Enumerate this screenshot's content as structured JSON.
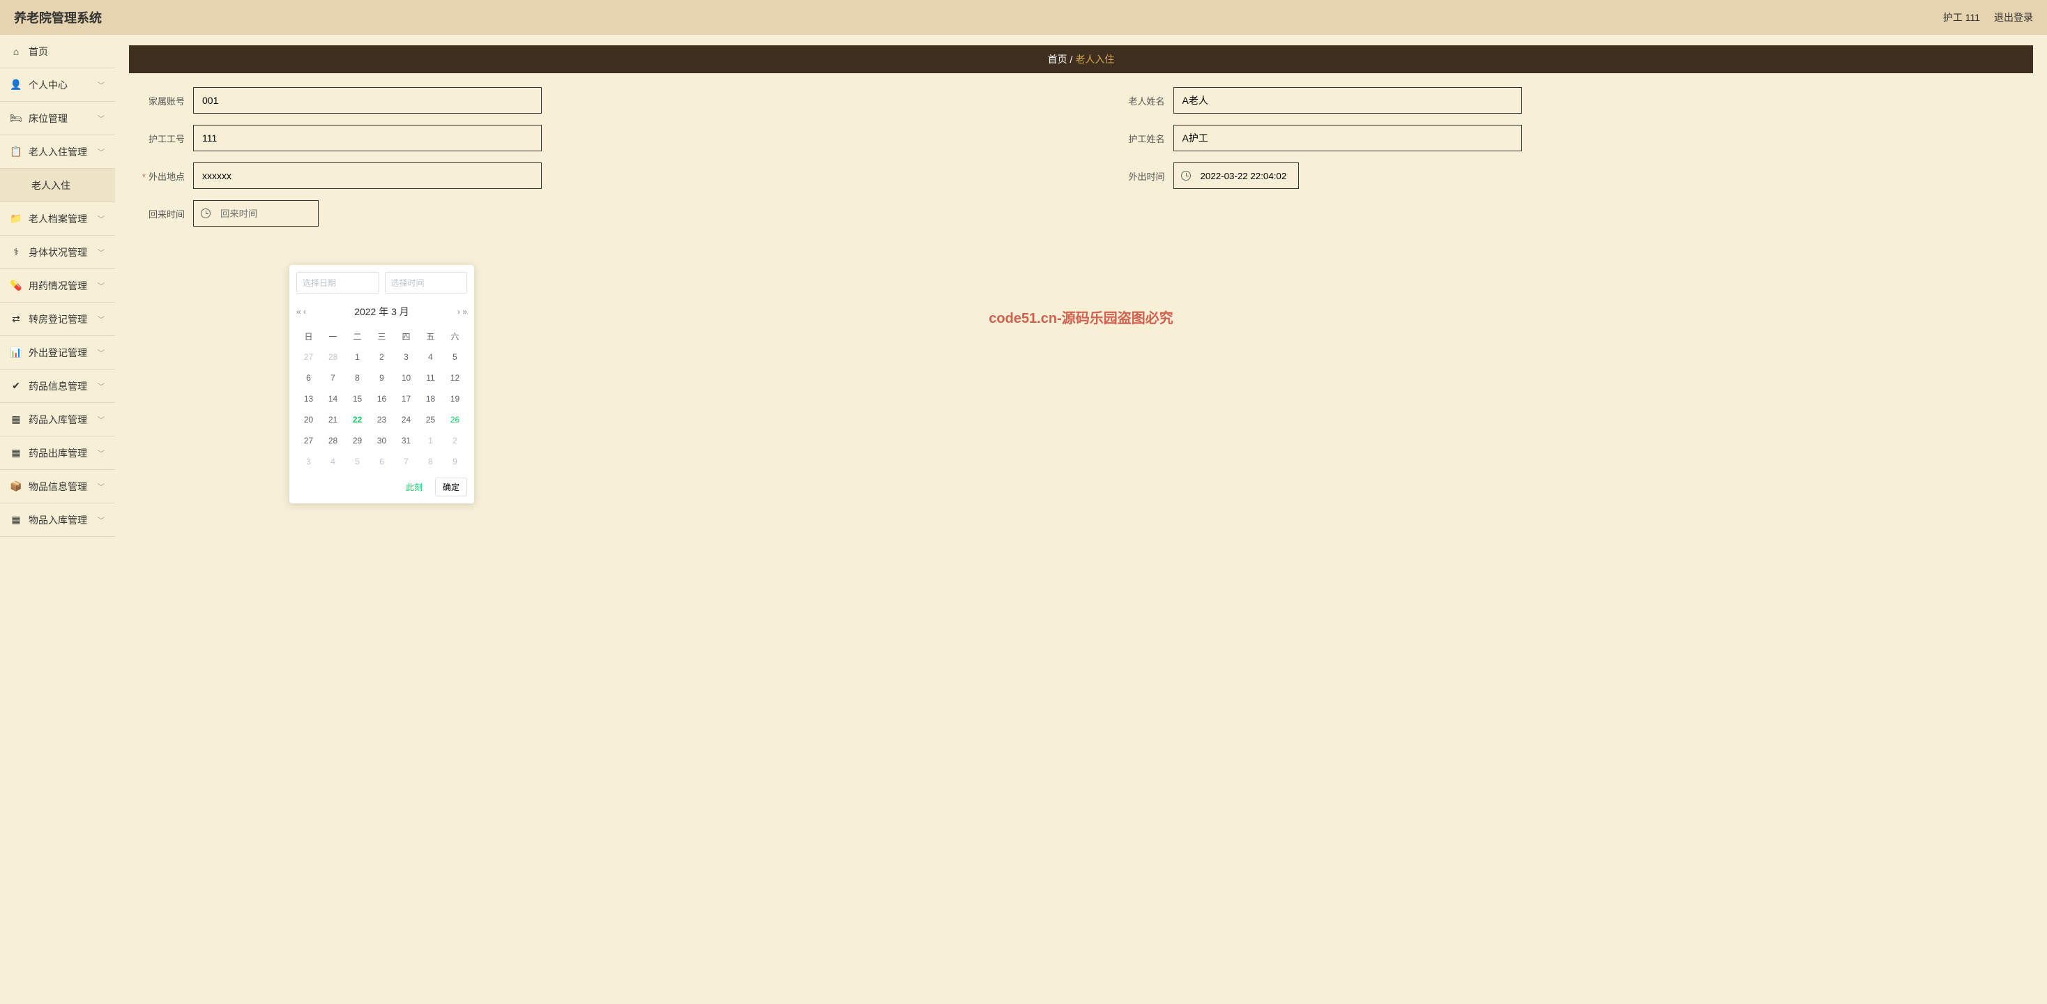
{
  "header": {
    "title": "养老院管理系统",
    "user_role": "护工 111",
    "logout": "退出登录"
  },
  "breadcrumb": {
    "home": "首页",
    "sep": " / ",
    "current": "老人入住"
  },
  "sidebar": [
    {
      "icon": "home",
      "label": "首页",
      "expandable": false
    },
    {
      "icon": "user",
      "label": "个人中心",
      "expandable": true
    },
    {
      "icon": "bed",
      "label": "床位管理",
      "expandable": true
    },
    {
      "icon": "checkin",
      "label": "老人入住管理",
      "expandable": true
    },
    {
      "icon": "",
      "label": "老人入住",
      "expandable": false,
      "sub": true
    },
    {
      "icon": "profile",
      "label": "老人档案管理",
      "expandable": true
    },
    {
      "icon": "body",
      "label": "身体状况管理",
      "expandable": true
    },
    {
      "icon": "med",
      "label": "用药情况管理",
      "expandable": true
    },
    {
      "icon": "room",
      "label": "转房登记管理",
      "expandable": true
    },
    {
      "icon": "out",
      "label": "外出登记管理",
      "expandable": true
    },
    {
      "icon": "drug",
      "label": "药品信息管理",
      "expandable": true
    },
    {
      "icon": "drugin",
      "label": "药品入库管理",
      "expandable": true
    },
    {
      "icon": "drugout",
      "label": "药品出库管理",
      "expandable": true
    },
    {
      "icon": "item",
      "label": "物品信息管理",
      "expandable": true
    },
    {
      "icon": "itemin",
      "label": "物品入库管理",
      "expandable": true
    }
  ],
  "form": {
    "family_account": {
      "label": "家属账号",
      "value": "001"
    },
    "elder_name": {
      "label": "老人姓名",
      "value": "A老人"
    },
    "nurse_id": {
      "label": "护工工号",
      "value": "111"
    },
    "nurse_name": {
      "label": "护工姓名",
      "value": "A护工"
    },
    "out_place": {
      "label": "外出地点",
      "value": "xxxxxx"
    },
    "out_time": {
      "label": "外出时间",
      "value": "2022-03-22 22:04:02"
    },
    "return_time": {
      "label": "回来时间",
      "placeholder": "回来时间"
    }
  },
  "datepicker": {
    "date_ph": "选择日期",
    "time_ph": "选择时间",
    "title": "2022 年   3 月",
    "weekdays": [
      "日",
      "一",
      "二",
      "三",
      "四",
      "五",
      "六"
    ],
    "weeks": [
      [
        {
          "d": 27,
          "o": true
        },
        {
          "d": 28,
          "o": true
        },
        {
          "d": 1
        },
        {
          "d": 2
        },
        {
          "d": 3
        },
        {
          "d": 4
        },
        {
          "d": 5
        }
      ],
      [
        {
          "d": 6
        },
        {
          "d": 7
        },
        {
          "d": 8
        },
        {
          "d": 9
        },
        {
          "d": 10
        },
        {
          "d": 11
        },
        {
          "d": 12
        }
      ],
      [
        {
          "d": 13
        },
        {
          "d": 14
        },
        {
          "d": 15
        },
        {
          "d": 16
        },
        {
          "d": 17
        },
        {
          "d": 18
        },
        {
          "d": 19
        }
      ],
      [
        {
          "d": 20
        },
        {
          "d": 21
        },
        {
          "d": 22,
          "t": true
        },
        {
          "d": 23
        },
        {
          "d": 24
        },
        {
          "d": 25
        },
        {
          "d": 26,
          "h": true
        }
      ],
      [
        {
          "d": 27
        },
        {
          "d": 28
        },
        {
          "d": 29
        },
        {
          "d": 30
        },
        {
          "d": 31
        },
        {
          "d": 1,
          "o": true
        },
        {
          "d": 2,
          "o": true
        }
      ],
      [
        {
          "d": 3,
          "o": true
        },
        {
          "d": 4,
          "o": true
        },
        {
          "d": 5,
          "o": true
        },
        {
          "d": 6,
          "o": true
        },
        {
          "d": 7,
          "o": true
        },
        {
          "d": 8,
          "o": true
        },
        {
          "d": 9,
          "o": true
        }
      ]
    ],
    "now_btn": "此刻",
    "ok_btn": "确定"
  },
  "watermark": "code51.cn-源码乐园盗图必究"
}
